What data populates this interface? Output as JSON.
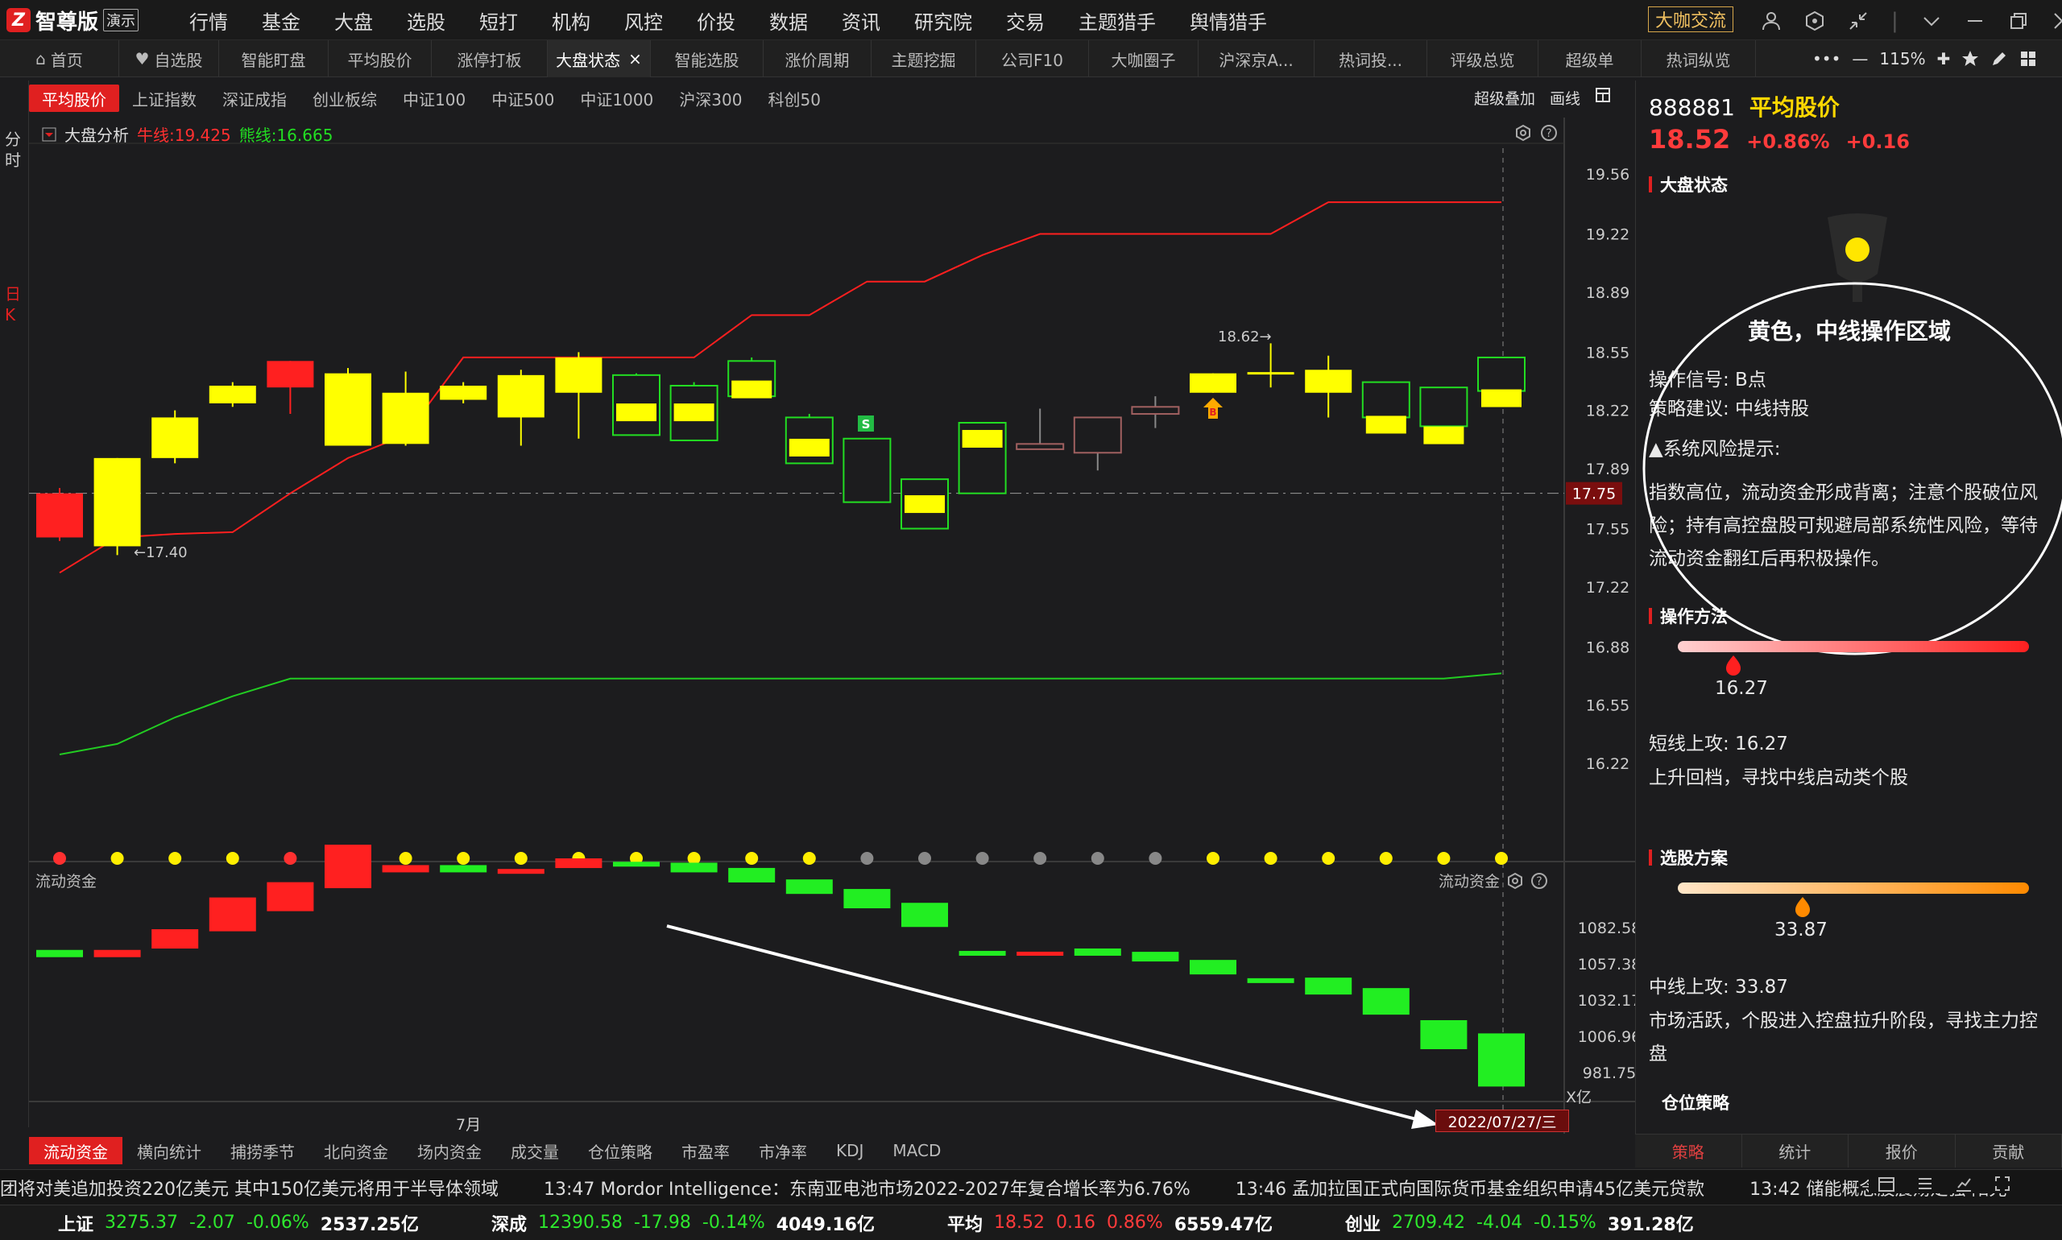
{
  "app": {
    "logo_mark": "Z",
    "name": "智尊版",
    "badge": "演示"
  },
  "menu": [
    "行情",
    "基金",
    "大盘",
    "选股",
    "短打",
    "机构",
    "风控",
    "价投",
    "数据",
    "资讯",
    "研究院",
    "交易",
    "主题猎手",
    "舆情猎手"
  ],
  "chat_button": "大咖交流",
  "window_icons": {
    "user": "user-icon",
    "cube": "cube-icon",
    "shrink": "shrink-icon",
    "menu": "chevron-down-icon",
    "min": "minimize-icon",
    "max": "maximize-icon",
    "close": "close-icon"
  },
  "tabs": [
    "首页",
    "自选股",
    "智能盯盘",
    "平均股价",
    "涨停打板",
    "大盘状态",
    "智能选股",
    "涨价周期",
    "主题挖掘",
    "公司F10",
    "大咖圈子",
    "沪深京A...",
    "热词投...",
    "评级总览",
    "超级单",
    "热词纵览"
  ],
  "active_tab": "大盘状态",
  "tab_close": "×",
  "zoom": "115%",
  "zoom_more": "•••",
  "zoom_minus": "—",
  "zoom_plus": "✚",
  "subtabs": [
    "平均股价",
    "上证指数",
    "深证成指",
    "创业板综",
    "中证100",
    "中证500",
    "中证1000",
    "沪深300",
    "科创50"
  ],
  "tools": {
    "overlay": "超级叠加",
    "draw": "画线"
  },
  "left_strip": {
    "fenshi": "分时",
    "rik": "日K"
  },
  "indicator": {
    "name": "大盘分析",
    "bull": "牛线:19.425",
    "bear": "熊线:16.665"
  },
  "flow_label": "流动资金",
  "month_label": "7月",
  "date_label": "2022/07/27/三",
  "unit_label": "X亿",
  "price_axis": [
    "19.56",
    "19.22",
    "18.89",
    "18.55",
    "18.22",
    "17.89",
    "17.55",
    "17.22",
    "16.88",
    "16.55",
    "16.22"
  ],
  "current_price_tag": "17.75",
  "flow_axis": [
    "1082.58",
    "1057.38",
    "1032.17",
    "1006.96",
    "981.75"
  ],
  "annotations": {
    "high": "18.62→",
    "low": "←17.40",
    "s": "S",
    "b": "B"
  },
  "chart_data": {
    "type": "candlestick",
    "candles": [
      {
        "o": 17.75,
        "c": 17.5,
        "h": 17.78,
        "l": 17.48,
        "color": "red"
      },
      {
        "o": 17.45,
        "c": 17.95,
        "h": 17.95,
        "l": 17.4,
        "color": "yellow"
      },
      {
        "o": 17.95,
        "c": 18.18,
        "h": 18.22,
        "l": 17.92,
        "color": "yellow"
      },
      {
        "o": 18.26,
        "c": 18.36,
        "h": 18.38,
        "l": 18.24,
        "color": "yellow"
      },
      {
        "o": 18.5,
        "c": 18.35,
        "h": 18.5,
        "l": 18.2,
        "color": "red"
      },
      {
        "o": 18.02,
        "c": 18.43,
        "h": 18.46,
        "l": 18.02,
        "color": "yellow"
      },
      {
        "o": 18.03,
        "c": 18.32,
        "h": 18.44,
        "l": 18.02,
        "color": "yellow"
      },
      {
        "o": 18.28,
        "c": 18.36,
        "h": 18.38,
        "l": 18.26,
        "color": "yellow"
      },
      {
        "o": 18.18,
        "c": 18.42,
        "h": 18.45,
        "l": 18.02,
        "color": "yellow"
      },
      {
        "o": 18.32,
        "c": 18.52,
        "h": 18.55,
        "l": 18.06,
        "color": "yellow"
      },
      {
        "o": 18.42,
        "c": 18.08,
        "h": 18.43,
        "l": 18.08,
        "color": "green",
        "mid": 18.25
      },
      {
        "o": 18.36,
        "c": 18.05,
        "h": 18.38,
        "l": 18.05,
        "color": "green",
        "mid": 18.25
      },
      {
        "o": 18.5,
        "c": 18.3,
        "h": 18.52,
        "l": 18.3,
        "color": "green",
        "mid": 18.38
      },
      {
        "o": 18.18,
        "c": 17.92,
        "h": 18.2,
        "l": 17.92,
        "color": "green",
        "mid": 18.05
      },
      {
        "o": 18.06,
        "c": 17.7,
        "h": 18.06,
        "l": 17.7,
        "color": "green"
      },
      {
        "o": 17.83,
        "c": 17.55,
        "h": 17.83,
        "l": 17.55,
        "color": "green",
        "mid": 17.73
      },
      {
        "o": 18.15,
        "c": 17.75,
        "h": 18.15,
        "l": 17.75,
        "color": "green",
        "mid": 18.1
      },
      {
        "o": 18.03,
        "c": 18.0,
        "h": 18.23,
        "l": 18.0,
        "color": "gray"
      },
      {
        "o": 18.18,
        "c": 17.98,
        "h": 18.18,
        "l": 17.88,
        "color": "gray"
      },
      {
        "o": 18.24,
        "c": 18.2,
        "h": 18.3,
        "l": 18.12,
        "color": "gray"
      },
      {
        "o": 18.32,
        "c": 18.43,
        "h": 18.43,
        "l": 18.32,
        "color": "yellow"
      },
      {
        "o": 18.43,
        "c": 18.43,
        "h": 18.6,
        "l": 18.35,
        "color": "yellow",
        "doji": true
      },
      {
        "o": 18.32,
        "c": 18.45,
        "h": 18.53,
        "l": 18.18,
        "color": "yellow"
      },
      {
        "o": 18.18,
        "c": 18.38,
        "h": 18.38,
        "l": 18.15,
        "color": "green",
        "mid": 18.18
      },
      {
        "o": 18.13,
        "c": 18.35,
        "h": 18.35,
        "l": 18.1,
        "color": "green",
        "mid": 18.12
      },
      {
        "o": 18.33,
        "c": 18.52,
        "h": 18.52,
        "l": 18.3,
        "color": "green",
        "mid": 18.33
      }
    ],
    "bull_line": [
      17.3,
      17.5,
      17.52,
      17.53,
      17.75,
      17.95,
      18.08,
      18.52,
      18.52,
      18.52,
      18.52,
      18.52,
      18.76,
      18.76,
      18.95,
      18.95,
      19.1,
      19.22,
      19.22,
      19.22,
      19.22,
      19.22,
      19.4,
      19.4,
      19.4,
      19.4
    ],
    "bear_line": [
      16.27,
      16.33,
      16.48,
      16.6,
      16.7,
      16.7,
      16.7,
      16.7,
      16.7,
      16.7,
      16.7,
      16.7,
      16.7,
      16.7,
      16.7,
      16.7,
      16.7,
      16.7,
      16.7,
      16.7,
      16.7,
      16.7,
      16.7,
      16.7,
      16.7,
      16.73
    ],
    "signal_dots": [
      "red",
      "yellow",
      "yellow",
      "yellow",
      "red",
      "yellow",
      "yellow",
      "yellow",
      "yellow",
      "yellow",
      "yellow",
      "yellow",
      "yellow",
      "yellow",
      "gray",
      "gray",
      "gray",
      "gray",
      "gray",
      "gray",
      "yellow",
      "yellow",
      "yellow",
      "yellow",
      "yellow",
      "yellow"
    ],
    "flow": [
      {
        "v": 1062,
        "h": 3,
        "color": "green"
      },
      {
        "v": 1062,
        "h": 3,
        "color": "red"
      },
      {
        "v": 1068,
        "h": 8,
        "color": "red"
      },
      {
        "v": 1080,
        "h": 14,
        "color": "red"
      },
      {
        "v": 1094,
        "h": 12,
        "color": "red"
      },
      {
        "v": 1110,
        "h": 18,
        "color": "red"
      },
      {
        "v": 1121,
        "h": 3,
        "color": "red"
      },
      {
        "v": 1121,
        "h": 3,
        "color": "green"
      },
      {
        "v": 1120,
        "h": 2,
        "color": "red"
      },
      {
        "v": 1124,
        "h": 4,
        "color": "red"
      },
      {
        "v": 1125,
        "h": 2,
        "color": "green"
      },
      {
        "v": 1121,
        "h": 4,
        "color": "green"
      },
      {
        "v": 1114,
        "h": 6,
        "color": "green"
      },
      {
        "v": 1106,
        "h": 6,
        "color": "green"
      },
      {
        "v": 1096,
        "h": 8,
        "color": "green"
      },
      {
        "v": 1083,
        "h": 10,
        "color": "green"
      },
      {
        "v": 1063,
        "h": 2,
        "color": "green"
      },
      {
        "v": 1063,
        "h": 1,
        "color": "red"
      },
      {
        "v": 1063,
        "h": 3,
        "color": "green"
      },
      {
        "v": 1059,
        "h": 4,
        "color": "green"
      },
      {
        "v": 1050,
        "h": 6,
        "color": "green"
      },
      {
        "v": 1044,
        "h": 2,
        "color": "green"
      },
      {
        "v": 1036,
        "h": 7,
        "color": "green"
      },
      {
        "v": 1022,
        "h": 11,
        "color": "green"
      },
      {
        "v": 998,
        "h": 12,
        "color": "green"
      },
      {
        "v": 972,
        "h": 22,
        "color": "green"
      }
    ]
  },
  "panel": {
    "code": "888881",
    "name": "平均股价",
    "price": "18.52",
    "pct": "+0.86%",
    "chg": "+0.16",
    "section1": "大盘状态",
    "status_title": "黄色，中线操作区域",
    "signal": "操作信号: B点",
    "advice": "策略建议: 中线持股",
    "risk_title": "▲系统风险提示:",
    "risk_text": "指数高位，流动资金形成背离；注意个股破位风险；持有高控盘股可规避局部系统性风险，等待流动资金翻红后再积极操作。",
    "section2": "操作方法",
    "short_val": "16.27",
    "short_text1": "短线上攻: 16.27",
    "short_text2": "上升回档，寻找中线启动类个股",
    "section3": "选股方案",
    "mid_val": "33.87",
    "mid_text1": "中线上攻: 33.87",
    "mid_text2": "市场活跃，个股进入控盘拉升阶段，寻找主力控盘",
    "section4": "仓位策略",
    "tabs": [
      "策略",
      "统计",
      "报价",
      "贡献"
    ]
  },
  "bottom_tabs": [
    "流动资金",
    "横向统计",
    "捕捞季节",
    "北向资金",
    "场内资金",
    "成交量",
    "仓位策略",
    "市盈率",
    "市净率",
    "KDJ",
    "MACD"
  ],
  "news": [
    "团将对美追加投资220亿美元 其中150亿美元将用于半导体领域",
    "13:47 Mordor Intelligence：东南亚电池市场2022-2027年复合增长率为6.76%",
    "13:46 孟加拉国正式向国际货币基金组织申请45亿美元贷款",
    "13:42 储能概念股震荡走强 阳光"
  ],
  "status": [
    {
      "name": "上证",
      "val": "3275.37",
      "chg": "-2.07",
      "pct": "-0.06%",
      "amt": "2537.25亿",
      "dir": "down"
    },
    {
      "name": "深成",
      "val": "12390.58",
      "chg": "-17.98",
      "pct": "-0.14%",
      "amt": "4049.16亿",
      "dir": "down"
    },
    {
      "name": "平均",
      "val": "18.52",
      "chg": "0.16",
      "pct": "0.86%",
      "amt": "6559.47亿",
      "dir": "up"
    },
    {
      "name": "创业",
      "val": "2709.42",
      "chg": "-4.04",
      "pct": "-0.15%",
      "amt": "391.28亿",
      "dir": "down"
    }
  ],
  "colors": {
    "red": "#ff2a2a",
    "yellow": "#ffff00",
    "green": "#22dd22",
    "bg": "#1c1c1e"
  }
}
